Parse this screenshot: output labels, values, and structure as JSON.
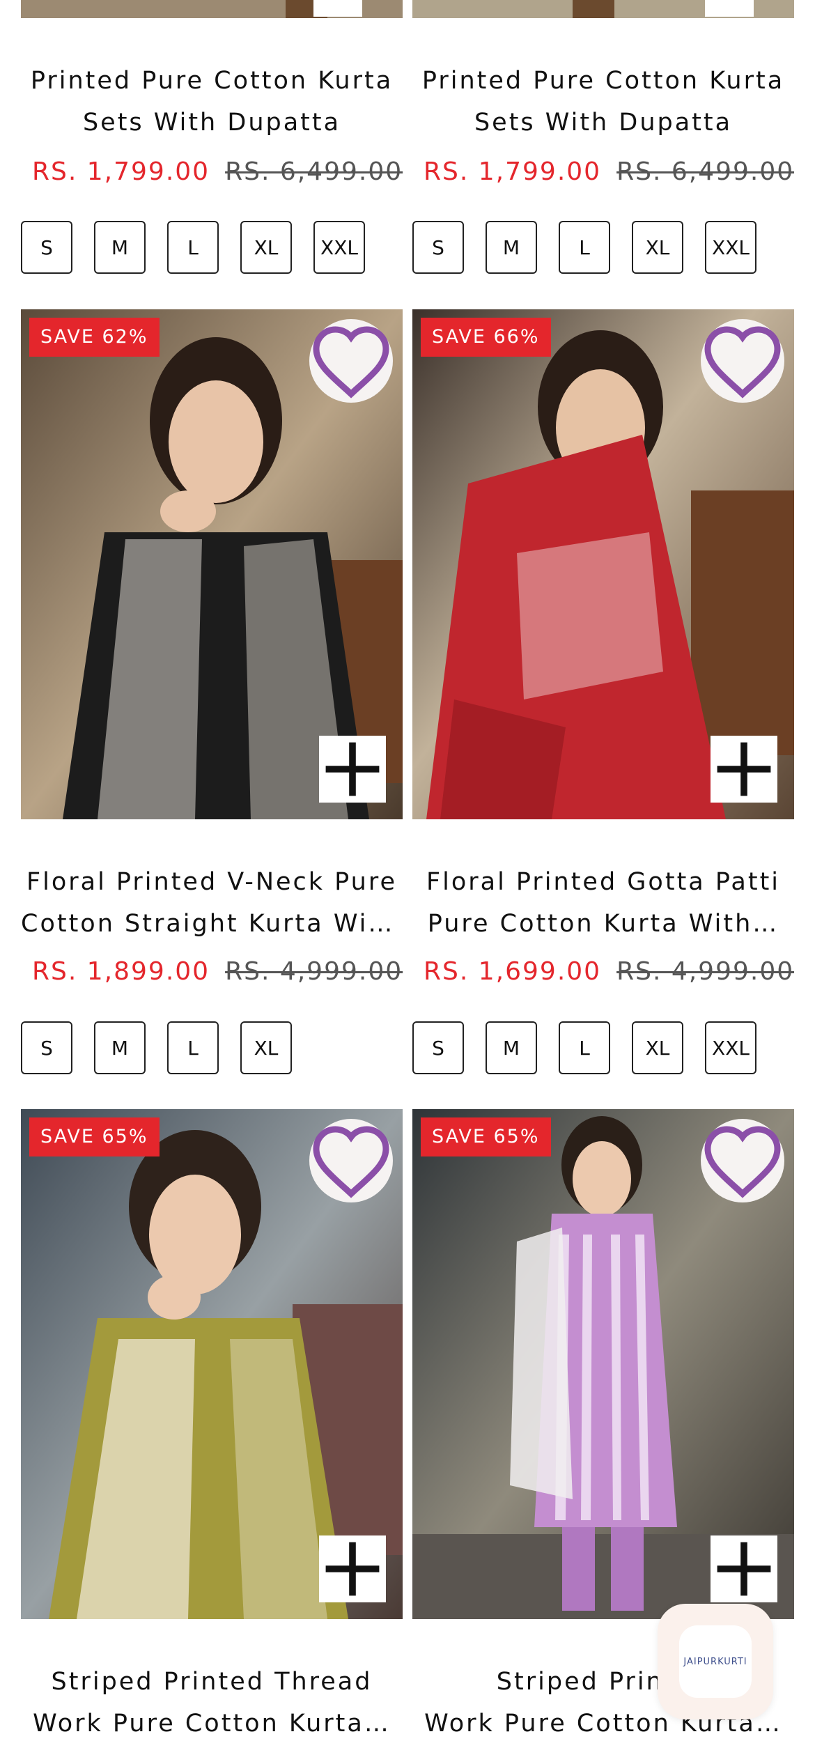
{
  "products": [
    {
      "title_lines": [
        "Printed Pure Cotton Kurta",
        "Sets With Dupatta"
      ],
      "price": "RS. 1,799.00",
      "compare_price": "RS. 6,499.00",
      "sizes": [
        "S",
        "M",
        "L",
        "XL",
        "XXL"
      ]
    },
    {
      "title_lines": [
        "Printed Pure Cotton Kurta",
        "Sets With Dupatta"
      ],
      "price": "RS. 1,799.00",
      "compare_price": "RS. 6,499.00",
      "sizes": [
        "S",
        "M",
        "L",
        "XL",
        "XXL"
      ]
    },
    {
      "badge": "SAVE 62%",
      "title_lines": [
        "Floral Printed V-Neck Pure",
        "Cotton Straight Kurta With…"
      ],
      "price": "RS. 1,899.00",
      "compare_price": "RS. 4,999.00",
      "sizes": [
        "S",
        "M",
        "L",
        "XL"
      ]
    },
    {
      "badge": "SAVE 66%",
      "title_lines": [
        "Floral Printed Gotta Patti",
        "Pure Cotton Kurta With…"
      ],
      "price": "RS. 1,699.00",
      "compare_price": "RS. 4,999.00",
      "sizes": [
        "S",
        "M",
        "L",
        "XL",
        "XXL"
      ]
    },
    {
      "badge": "SAVE 65%",
      "title_lines": [
        "Striped Printed Thread",
        "Work Pure Cotton Kurta…"
      ]
    },
    {
      "badge": "SAVE 65%",
      "title_lines": [
        "Striped Printed",
        "Work Pure Cotton Kurta…"
      ]
    }
  ],
  "icons": {
    "wishlist": "heart-outline-icon",
    "quick_add": "plus-icon"
  },
  "colors": {
    "sale_red": "#e4262c",
    "heart_purple": "#8b4fa8",
    "badge_text": "#ffffff"
  },
  "chat_widget": {
    "logo_text": "JAIPURKURTI"
  }
}
